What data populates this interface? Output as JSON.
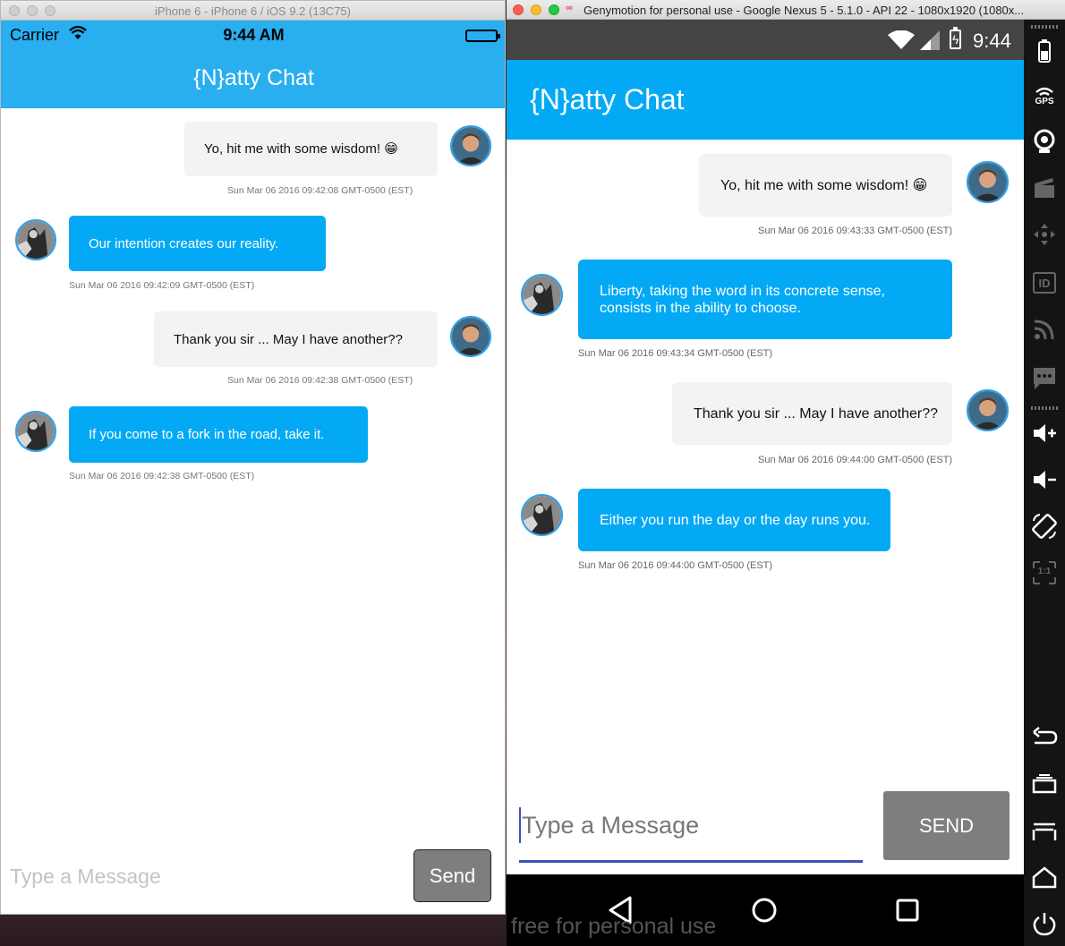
{
  "ios": {
    "window_title": "iPhone 6 - iPhone 6 / iOS 9.2 (13C75)",
    "status": {
      "carrier": "Carrier",
      "time": "9:44 AM"
    },
    "app_title": "{N}atty Chat",
    "messages": [
      {
        "side": "outgoing",
        "text": "Yo, hit me with some wisdom! 😁",
        "timestamp": "Sun Mar 06 2016 09:42:08 GMT-0500 (EST)"
      },
      {
        "side": "incoming",
        "text": "Our intention creates our reality.",
        "timestamp": "Sun Mar 06 2016 09:42:09 GMT-0500 (EST)"
      },
      {
        "side": "outgoing",
        "text": "Thank you sir ... May I have another??",
        "timestamp": "Sun Mar 06 2016 09:42:38 GMT-0500 (EST)"
      },
      {
        "side": "incoming",
        "text": "If you come to a fork in the road, take it.",
        "timestamp": "Sun Mar 06 2016 09:42:38 GMT-0500 (EST)"
      }
    ],
    "input": {
      "placeholder": "Type a Message",
      "value": ""
    },
    "send_label": "Send"
  },
  "android": {
    "window_title": "Genymotion for personal use - Google Nexus 5 - 5.1.0 - API 22 - 1080x1920 (1080x...",
    "status": {
      "time": "9:44"
    },
    "app_title": "{N}atty Chat",
    "messages": [
      {
        "side": "outgoing",
        "text": "Yo, hit me with some wisdom! 😁",
        "timestamp": "Sun Mar 06 2016 09:43:33 GMT-0500 (EST)"
      },
      {
        "side": "incoming",
        "text": "Liberty, taking the word in its concrete sense, consists in the ability to choose.",
        "timestamp": "Sun Mar 06 2016 09:43:34 GMT-0500 (EST)"
      },
      {
        "side": "outgoing",
        "text": "Thank you sir ... May I have another??",
        "timestamp": "Sun Mar 06 2016 09:44:00 GMT-0500 (EST)"
      },
      {
        "side": "incoming",
        "text": "Either you run the day or the day runs you.",
        "timestamp": "Sun Mar 06 2016 09:44:00 GMT-0500 (EST)"
      }
    ],
    "input": {
      "placeholder": "Type a Message",
      "value": ""
    },
    "send_label": "SEND",
    "watermark": "free for personal use"
  },
  "genymotion_toolbar": {
    "gps_label": "GPS",
    "id_label": "ID",
    "ratio_label": "1:1",
    "icons": [
      "battery-icon",
      "gps-icon",
      "webcam-icon",
      "capture-icon",
      "remote-control-icon",
      "id-icon",
      "network-icon",
      "sms-icon",
      "volume-up-icon",
      "volume-down-icon",
      "rotate-icon",
      "pixel-perfect-icon",
      "back-icon",
      "recent-apps-icon",
      "menu-icon",
      "home-icon",
      "power-icon"
    ]
  },
  "colors": {
    "ios_bar": "#29aef0",
    "accent": "#03a9f4",
    "outgoing_bubble": "#f3f3f3",
    "send_button": "#7e7e7e",
    "android_input_line": "#3f51b5"
  }
}
